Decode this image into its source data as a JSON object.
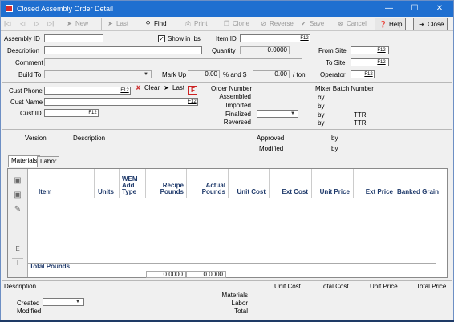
{
  "window": {
    "title": "Closed Assembly Order Detail",
    "minimize_glyph": "—",
    "maximize_glyph": "☐",
    "close_glyph": "✕"
  },
  "toolbar": {
    "new": "New",
    "last": "Last",
    "find": "Find",
    "print": "Print",
    "clone": "Clone",
    "reverse": "Reverse",
    "save": "Save",
    "cancel": "Cancel",
    "help": "Help",
    "close": "Close"
  },
  "header": {
    "assembly_id_label": "Assembly ID",
    "assembly_id_value": "",
    "show_in_lbs_label": "Show in lbs",
    "show_in_lbs_checked": true,
    "item_id_label": "Item ID",
    "description_label": "Description",
    "quantity_label": "Quantity",
    "quantity_value": "0.0000",
    "comment_label": "Comment",
    "build_to_label": "Build To",
    "markup_label": "Mark Up",
    "markup_pct_value": "0.00",
    "markup_pct_unit": "% and $",
    "markup_dollar_value": "0.00",
    "per_ton_label": "/ ton",
    "from_site_label": "From Site",
    "to_site_label": "To Site",
    "operator_label": "Operator",
    "f12": "F12"
  },
  "customer": {
    "phone_label": "Cust Phone",
    "name_label": "Cust Name",
    "id_label": "Cust ID",
    "clear_label": "Clear",
    "last_label": "Last",
    "f_label": "F"
  },
  "order_status": {
    "order_number_label": "Order Number",
    "assembled_label": "Assembled",
    "imported_label": "Imported",
    "finalized_label": "Finalized",
    "reversed_label": "Reversed",
    "mixer_batch_label": "Mixer Batch Number",
    "by": "by",
    "finalized_by_value": "TTR",
    "reversed_by_value": "TTR"
  },
  "version": {
    "version_label": "Version",
    "description_label": "Description",
    "approved_label": "Approved",
    "modified_label": "Modified",
    "by": "by"
  },
  "tabs": [
    {
      "label": "Materials",
      "selected": true
    },
    {
      "label": "Labor",
      "selected": false
    }
  ],
  "grid": {
    "side_letters": [
      "E",
      "I"
    ],
    "columns": [
      "Item",
      "Units",
      "WEM Add Type",
      "Recipe Pounds",
      "Actual Pounds",
      "Unit Cost",
      "Ext Cost",
      "Unit Price",
      "Ext Price",
      "Banked Grain"
    ],
    "total_label": "Total Pounds",
    "total_recipe": "0.0000",
    "total_actual": "0.0000"
  },
  "footer": {
    "description_label": "Description",
    "unit_cost_label": "Unit Cost",
    "total_cost_label": "Total Cost",
    "unit_price_label": "Unit Price",
    "total_price_label": "Total Price",
    "materials_label": "Materials",
    "labor_label": "Labor",
    "total_label": "Total",
    "created_label": "Created",
    "modified_label": "Modified"
  },
  "colors": {
    "titlebar": "#1f6fd0",
    "grid_header_text": "#1f3a6b"
  }
}
